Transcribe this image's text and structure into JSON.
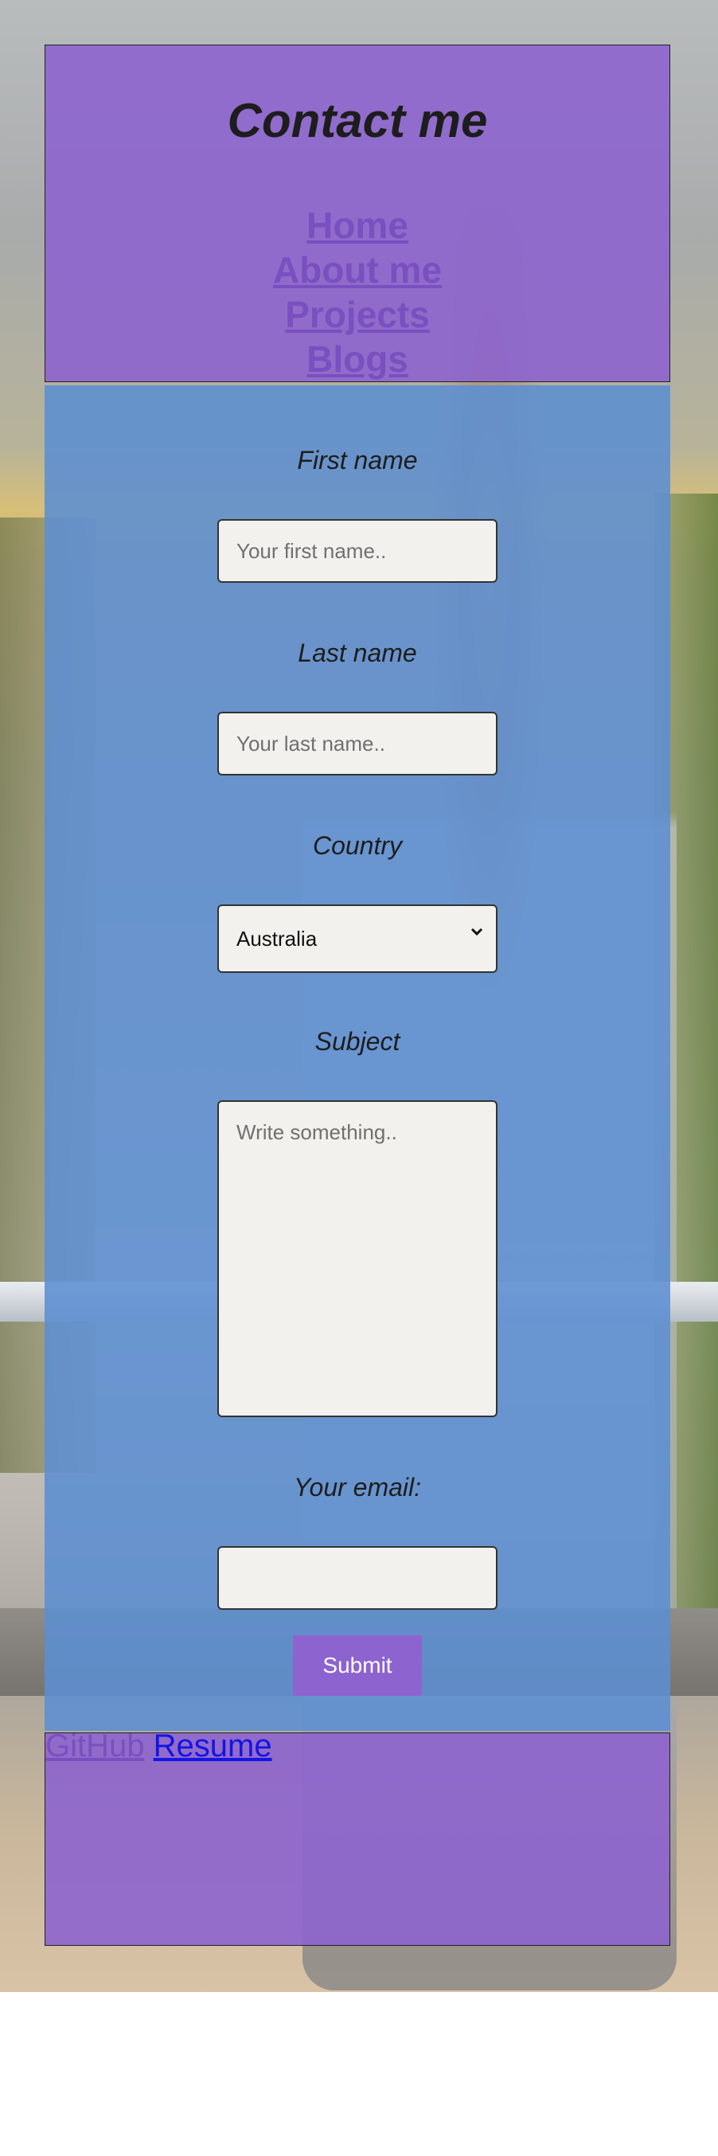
{
  "header": {
    "title": "Contact me",
    "nav": [
      "Home",
      "About me",
      "Projects",
      "Blogs"
    ]
  },
  "form": {
    "first_name_label": "First name",
    "first_name_placeholder": "Your first name..",
    "last_name_label": "Last name",
    "last_name_placeholder": "Your last name..",
    "country_label": "Country",
    "country_selected": "Australia",
    "subject_label": "Subject",
    "subject_placeholder": "Write something..",
    "email_label": "Your email:",
    "email_value": "",
    "submit_label": "Submit"
  },
  "footer": {
    "links": [
      "GitHub",
      "Resume"
    ]
  },
  "colors": {
    "header_bg": "#8d64ce",
    "form_bg": "#5c8ed2",
    "nav_link": "#7a4fc0",
    "button_bg": "#8d63cf",
    "resume_link": "#1414e6"
  }
}
